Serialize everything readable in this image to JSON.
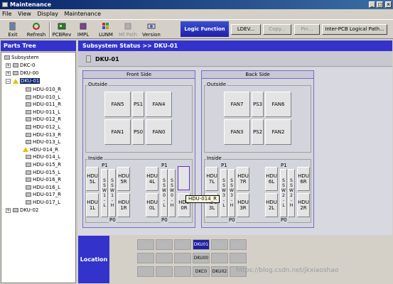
{
  "window": {
    "title": "Maintenance",
    "controls": [
      "_",
      "□",
      "×"
    ]
  },
  "menu": [
    "File",
    "View",
    "Display",
    "Maintenance"
  ],
  "toolbar": {
    "exit": "Exit",
    "refresh": "Refresh",
    "pcbrev": "PCBRev",
    "impl": "IMPL",
    "lunm": "LUNM",
    "mf_path": "Mf Path",
    "version": "Version"
  },
  "logic": {
    "title": "Logic Function",
    "ldev": "LDEV...",
    "copy": "Copy...",
    "pin": "Pin...",
    "inter_pcb": "Inter-PCB Logical Path..."
  },
  "parts_tree": {
    "title": "Parts Tree",
    "root": "Subsystem",
    "nodes": [
      "DKC-0",
      "DKU-00",
      "DKU-01"
    ],
    "hdus": [
      "HDU-010_R",
      "HDU-010_L",
      "HDU-011_R",
      "HDU-011_L",
      "HDU-012_R",
      "HDU-012_L",
      "HDU-013_R",
      "HDU-013_L",
      "HDU-014_R",
      "HDU-014_L",
      "HDU-015_R",
      "HDU-015_L",
      "HDU-016_R",
      "HDU-016_L",
      "HDU-017_R",
      "HDU-017_L"
    ],
    "last": "DKU-02"
  },
  "status": {
    "breadcrumb": "Subsystem Status >> DKU-01",
    "unit": "DKU-01"
  },
  "front": {
    "title": "Front Side",
    "outside": "Outside",
    "inside": "Inside",
    "fans_top": [
      "FAN5",
      "FAN4"
    ],
    "ps_top": "PS1",
    "fans_bot": [
      "FAN1",
      "FAN0"
    ],
    "ps_bot": "PS0",
    "hdu_a": [
      "HDU\n5L",
      "HDU\n1L"
    ],
    "sw_a": "S\nS\nW\n1\n-\nL",
    "sw_b": "S\nS\nW\n1\n-\nH",
    "hdu_b": [
      "HDU\n5R",
      "HDU\n1R"
    ],
    "hdu_c": [
      "HDU\n4L",
      "HDU\n0L"
    ],
    "sw_c": "S\nS\nW\n0\n-\nL",
    "sw_d": "S\nS\nW\n0\n-\nH",
    "hdu_d": [
      "",
      "HDU\n0R"
    ],
    "p1": "P1",
    "p0": "P0"
  },
  "back": {
    "title": "Back Side",
    "outside": "Outside",
    "inside": "Inside",
    "fans_top": [
      "FAN7",
      "FAN6"
    ],
    "ps_top": "PS3",
    "fans_bot": [
      "FAN3",
      "FAN2"
    ],
    "ps_bot": "PS2",
    "hdu_a": [
      "HDU\n7L",
      "HDU\n3L"
    ],
    "sw_a": "S\nS\nW\n3\n-\nL",
    "sw_b": "S\nS\nW\n3\n-\nH",
    "hdu_b": [
      "HDU\n7R",
      "HDU\n3R"
    ],
    "hdu_c": [
      "HDU\n6L",
      "HDU\n2L"
    ],
    "sw_c": "S\nS\nW\n2\n-\nL",
    "sw_d": "S\nS\nW\n2\n-\nH",
    "hdu_d": [
      "HDU\n6R",
      "HDU\n2R"
    ],
    "p1": "P1",
    "p0": "P0"
  },
  "tooltip": "HDU-014_R",
  "location": {
    "label": "Location",
    "cells": [
      "DKU01",
      "DKU00",
      "DKC0",
      "DKU02"
    ]
  },
  "watermark": "https://blog.csdn.net/jkxiaoshao",
  "colors": {
    "accent": "#3333cc",
    "title_bar": "#0a246a",
    "warn": "#e8c000"
  }
}
